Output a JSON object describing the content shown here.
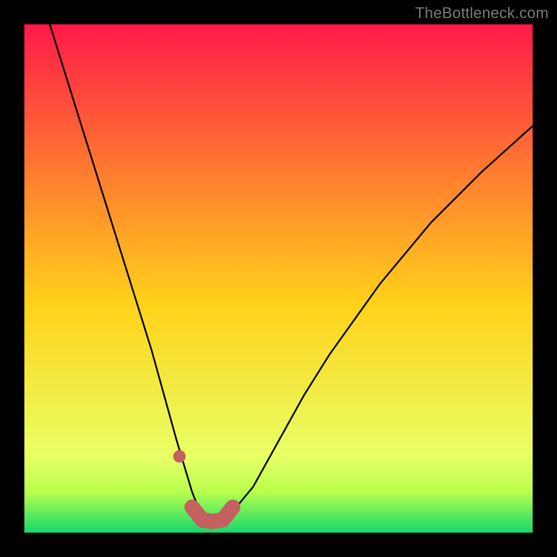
{
  "watermark": {
    "text": "TheBottleneck.com"
  },
  "colors": {
    "top": "#ff1a48",
    "mid": "#ffd21a",
    "green1": "#b8ff4d",
    "green2": "#14d96b",
    "curve": "#000000",
    "marker": "#c46060"
  },
  "chart_data": {
    "type": "line",
    "title": "",
    "xlabel": "",
    "ylabel": "",
    "xlim": [
      0,
      100
    ],
    "ylim": [
      0,
      100
    ],
    "series": [
      {
        "name": "bottleneck-curve",
        "x": [
          5,
          10,
          15,
          20,
          25,
          30,
          33,
          35,
          37,
          40,
          45,
          50,
          55,
          60,
          70,
          80,
          90,
          100
        ],
        "values": [
          100,
          84,
          68,
          52,
          36,
          18,
          8,
          3,
          2,
          3,
          9,
          18,
          27,
          35,
          49,
          61,
          71,
          80
        ]
      }
    ],
    "markers": {
      "name": "highlighted-range",
      "x": [
        30.5,
        33,
        35,
        37,
        39,
        41
      ],
      "values": [
        15,
        5,
        2.5,
        2.2,
        2.5,
        5
      ]
    },
    "annotations": []
  }
}
